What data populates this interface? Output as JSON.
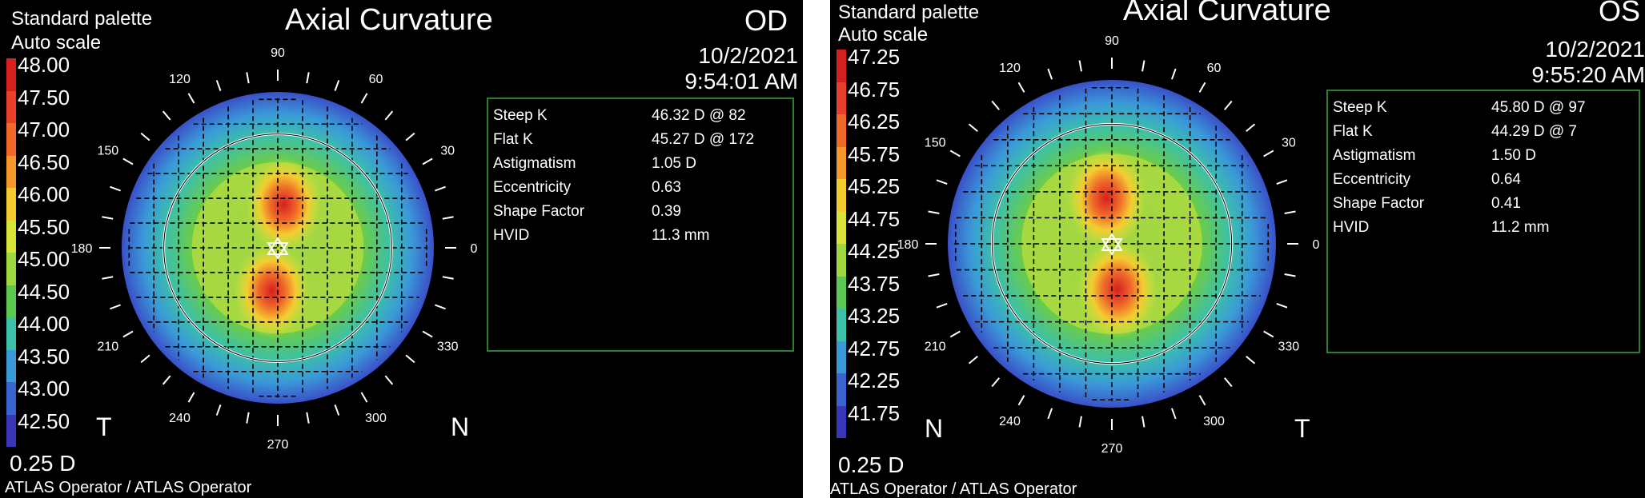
{
  "panels": [
    {
      "id": "od",
      "palette": "Standard palette",
      "scale_mode": "Auto scale",
      "title": "Axial Curvature",
      "eye": "OD",
      "date": "10/2/2021",
      "time": "9:54:01 AM",
      "scale_labels": [
        "48.00",
        "47.50",
        "47.00",
        "46.50",
        "46.00",
        "45.50",
        "45.00",
        "44.50",
        "44.00",
        "43.50",
        "43.00",
        "42.50"
      ],
      "step": "0.25 D",
      "left_letter": "T",
      "right_letter": "N",
      "operator": "ATLAS Operator / ATLAS Operator",
      "metrics": [
        {
          "label": "Steep K",
          "value": "46.32 D @ 82"
        },
        {
          "label": "Flat K",
          "value": "45.27 D @ 172"
        },
        {
          "label": "Astigmatism",
          "value": "1.05 D"
        },
        {
          "label": "Eccentricity",
          "value": "0.63"
        },
        {
          "label": "Shape Factor",
          "value": "0.39"
        },
        {
          "label": "HVID",
          "value": "11.3 mm"
        }
      ],
      "angles": [
        "0",
        "30",
        "60",
        "90",
        "120",
        "150",
        "180",
        "210",
        "240",
        "270",
        "300",
        "330"
      ]
    },
    {
      "id": "os",
      "palette": "Standard palette",
      "scale_mode": "Auto scale",
      "title": "Axial Curvature",
      "eye": "OS",
      "date": "10/2/2021",
      "time": "9:55:20 AM",
      "scale_labels": [
        "47.25",
        "46.75",
        "46.25",
        "45.75",
        "45.25",
        "44.75",
        "44.25",
        "43.75",
        "43.25",
        "42.75",
        "42.25",
        "41.75"
      ],
      "step": "0.25 D",
      "left_letter": "N",
      "right_letter": "T",
      "operator": "ATLAS Operator / ATLAS Operator",
      "metrics": [
        {
          "label": "Steep K",
          "value": "45.80 D @ 97"
        },
        {
          "label": "Flat K",
          "value": "44.29 D @ 7"
        },
        {
          "label": "Astigmatism",
          "value": "1.50 D"
        },
        {
          "label": "Eccentricity",
          "value": "0.64"
        },
        {
          "label": "Shape Factor",
          "value": "0.41"
        },
        {
          "label": "HVID",
          "value": "11.2 mm"
        }
      ],
      "angles": [
        "0",
        "30",
        "60",
        "90",
        "120",
        "150",
        "180",
        "210",
        "240",
        "270",
        "300",
        "330"
      ]
    }
  ],
  "colors": {
    "scale": [
      "#d62020",
      "#e8402a",
      "#f0682a",
      "#f59a2a",
      "#f5cc30",
      "#d8e43a",
      "#9ed840",
      "#5cc850",
      "#3cc0a8",
      "#3a9ad8",
      "#3a64d0",
      "#3a36b8"
    ],
    "grid_box": "#2e7d32"
  }
}
